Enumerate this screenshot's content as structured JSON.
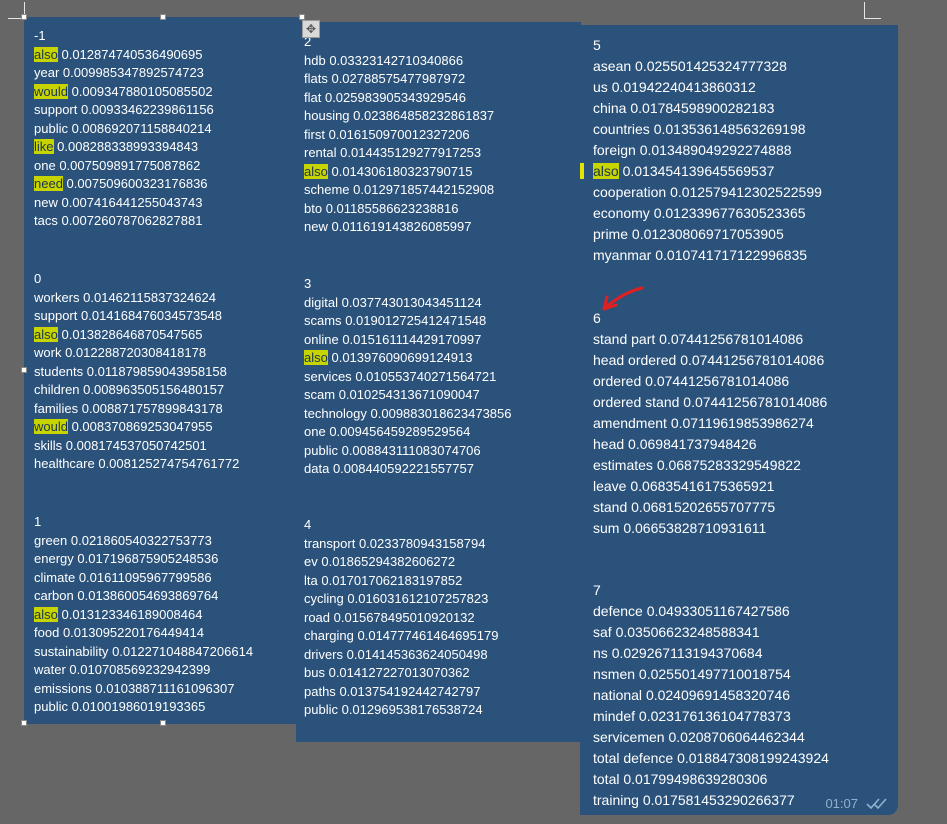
{
  "left": {
    "groups": [
      {
        "id": "-1",
        "rows": [
          {
            "word": "also",
            "value": "0.012874740536490695",
            "hl": true
          },
          {
            "word": "year",
            "value": "0.009985347892574723",
            "hl": false
          },
          {
            "word": "would",
            "value": "0.009347880105085502",
            "hl": true
          },
          {
            "word": "support",
            "value": "0.00933462239861156",
            "hl": false
          },
          {
            "word": "public",
            "value": "0.008692071158840214",
            "hl": false
          },
          {
            "word": "like",
            "value": "0.008288338993394843",
            "hl": true
          },
          {
            "word": "one",
            "value": "0.007509891775087862",
            "hl": false
          },
          {
            "word": "need",
            "value": "0.007509600323176836",
            "hl": true
          },
          {
            "word": "new",
            "value": "0.007416441255043743",
            "hl": false
          },
          {
            "word": "tacs",
            "value": "0.007260787062827881",
            "hl": false
          }
        ]
      },
      {
        "id": "0",
        "rows": [
          {
            "word": "workers",
            "value": "0.01462115837324624",
            "hl": false
          },
          {
            "word": "support",
            "value": "0.014168476034573548",
            "hl": false
          },
          {
            "word": "also",
            "value": "0.013828646870547565",
            "hl": true
          },
          {
            "word": "work",
            "value": "0.012288720308418178",
            "hl": false
          },
          {
            "word": "students",
            "value": "0.011879859043958158",
            "hl": false
          },
          {
            "word": "children",
            "value": "0.008963505156480157",
            "hl": false
          },
          {
            "word": "families",
            "value": "0.008871757899843178",
            "hl": false
          },
          {
            "word": "would",
            "value": "0.008370869253047955",
            "hl": true
          },
          {
            "word": "skills",
            "value": "0.008174537050742501",
            "hl": false
          },
          {
            "word": "healthcare",
            "value": "0.008125274754761772",
            "hl": false
          }
        ]
      },
      {
        "id": "1",
        "rows": [
          {
            "word": "green",
            "value": "0.021860540322753773",
            "hl": false
          },
          {
            "word": "energy",
            "value": "0.017196875905248536",
            "hl": false
          },
          {
            "word": "climate",
            "value": "0.01611095967799586",
            "hl": false
          },
          {
            "word": "carbon",
            "value": "0.013860054693869764",
            "hl": false
          },
          {
            "word": "also",
            "value": "0.013123346189008464",
            "hl": true
          },
          {
            "word": "food",
            "value": "0.013095220176449414",
            "hl": false
          },
          {
            "word": "sustainability",
            "value": "0.012271048847206614",
            "hl": false
          },
          {
            "word": "water",
            "value": "0.010708569232942399",
            "hl": false
          },
          {
            "word": "emissions",
            "value": "0.010388711161096307",
            "hl": false
          },
          {
            "word": "public",
            "value": "0.01001986019193365",
            "hl": false
          }
        ]
      }
    ]
  },
  "middle": {
    "groups": [
      {
        "id": "2",
        "rows": [
          {
            "word": "hdb",
            "value": "0.03323142710340866",
            "hl": false
          },
          {
            "word": "flats",
            "value": "0.02788575477987972",
            "hl": false
          },
          {
            "word": "flat",
            "value": "0.025983905343929546",
            "hl": false
          },
          {
            "word": "housing",
            "value": "0.023864858232861837",
            "hl": false
          },
          {
            "word": "first",
            "value": "0.016150970012327206",
            "hl": false
          },
          {
            "word": "rental",
            "value": "0.014435129277917253",
            "hl": false
          },
          {
            "word": "also",
            "value": "0.014306180323790715",
            "hl": true
          },
          {
            "word": "scheme",
            "value": "0.012971857442152908",
            "hl": false
          },
          {
            "word": "bto",
            "value": "0.01185586623238816",
            "hl": false
          },
          {
            "word": "new",
            "value": "0.011619143826085997",
            "hl": false
          }
        ]
      },
      {
        "id": "3",
        "rows": [
          {
            "word": "digital",
            "value": "0.037743013043451124",
            "hl": false
          },
          {
            "word": "scams",
            "value": "0.019012725412471548",
            "hl": false
          },
          {
            "word": "online",
            "value": "0.015161114429170997",
            "hl": false
          },
          {
            "word": "also",
            "value": "0.013976090699124913",
            "hl": true
          },
          {
            "word": "services",
            "value": "0.010553740271564721",
            "hl": false
          },
          {
            "word": "scam",
            "value": "0.010254313671090047",
            "hl": false
          },
          {
            "word": "technology",
            "value": "0.009883018623473856",
            "hl": false
          },
          {
            "word": "one",
            "value": "0.009456459289529564",
            "hl": false
          },
          {
            "word": "public",
            "value": "0.008843111083074706",
            "hl": false
          },
          {
            "word": "data",
            "value": "0.008440592221557757",
            "hl": false
          }
        ]
      },
      {
        "id": "4",
        "rows": [
          {
            "word": "transport",
            "value": "0.0233780943158794",
            "hl": false
          },
          {
            "word": "ev",
            "value": "0.01865294382606272",
            "hl": false
          },
          {
            "word": "lta",
            "value": "0.017017062183197852",
            "hl": false
          },
          {
            "word": "cycling",
            "value": "0.016031612107257823",
            "hl": false
          },
          {
            "word": "road",
            "value": "0.015678495010920132",
            "hl": false
          },
          {
            "word": "charging",
            "value": "0.014777461464695179",
            "hl": false
          },
          {
            "word": "drivers",
            "value": "0.014145363624050498",
            "hl": false
          },
          {
            "word": "bus",
            "value": "0.014127227013070362",
            "hl": false
          },
          {
            "word": "paths",
            "value": "0.013754192442742797",
            "hl": false
          },
          {
            "word": "public",
            "value": "0.012969538176538724",
            "hl": false
          }
        ]
      }
    ]
  },
  "right": {
    "groups": [
      {
        "id": "5",
        "rows": [
          {
            "word": "asean",
            "value": "0.025501425324777328",
            "hl": false
          },
          {
            "word": "us",
            "value": "0.01942240413860312",
            "hl": false
          },
          {
            "word": "china",
            "value": "0.01784598900282183",
            "hl": false
          },
          {
            "word": "countries",
            "value": "0.013536148563269198",
            "hl": false
          },
          {
            "word": "foreign",
            "value": "0.013489049292274888",
            "hl": false
          },
          {
            "word": "also",
            "value": "0.013454139645569537",
            "hl": true
          },
          {
            "word": "cooperation",
            "value": "0.012579412302522599",
            "hl": false
          },
          {
            "word": "economy",
            "value": "0.012339677630523365",
            "hl": false
          },
          {
            "word": "prime",
            "value": "0.012308069717053905",
            "hl": false
          },
          {
            "word": "myanmar",
            "value": "0.010741717122996835",
            "hl": false
          }
        ]
      },
      {
        "id": "6",
        "rows": [
          {
            "word": "stand part",
            "value": "0.07441256781014086",
            "hl": false
          },
          {
            "word": "head ordered",
            "value": "0.07441256781014086",
            "hl": false
          },
          {
            "word": "ordered",
            "value": "0.07441256781014086",
            "hl": false
          },
          {
            "word": "ordered stand",
            "value": "0.07441256781014086",
            "hl": false
          },
          {
            "word": "amendment",
            "value": "0.07119619853986274",
            "hl": false
          },
          {
            "word": "head",
            "value": "0.069841737948426",
            "hl": false
          },
          {
            "word": "estimates",
            "value": "0.06875283329549822",
            "hl": false
          },
          {
            "word": "leave",
            "value": "0.06835416175365921",
            "hl": false
          },
          {
            "word": "stand",
            "value": "0.06815202655707775",
            "hl": false
          },
          {
            "word": "sum",
            "value": "0.06653828710931611",
            "hl": false
          }
        ]
      },
      {
        "id": "7",
        "rows": [
          {
            "word": "defence",
            "value": "0.04933051167427586",
            "hl": false
          },
          {
            "word": "saf",
            "value": "0.03506623248588341",
            "hl": false
          },
          {
            "word": "ns",
            "value": "0.029267113194370684",
            "hl": false
          },
          {
            "word": "nsmen",
            "value": "0.025501497710018754",
            "hl": false
          },
          {
            "word": "national",
            "value": "0.02409691458320746",
            "hl": false
          },
          {
            "word": "mindef",
            "value": "0.023176136104778373",
            "hl": false
          },
          {
            "word": "servicemen",
            "value": "0.0208706064462344",
            "hl": false
          },
          {
            "word": "total defence",
            "value": "0.018847308199243924",
            "hl": false
          },
          {
            "word": "total",
            "value": "0.01799498639280306",
            "hl": false
          },
          {
            "word": "training",
            "value": "0.017581453290266377",
            "hl": false
          }
        ]
      }
    ],
    "timestamp": "01:07"
  },
  "icons": {
    "move": "move-icon",
    "read_ticks": "double-check-icon",
    "annotation_arrow": "red-arrow-annotation"
  },
  "colors": {
    "panel": "#2b527b",
    "highlight": "#c8d400",
    "background": "#666666",
    "arrow": "#e02020"
  }
}
